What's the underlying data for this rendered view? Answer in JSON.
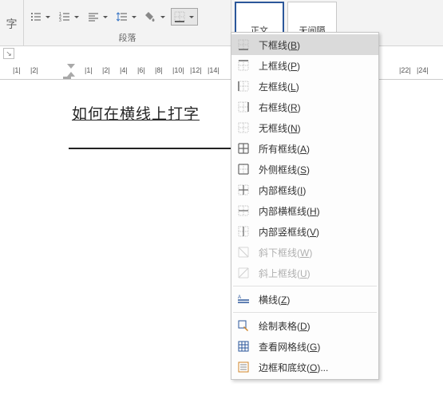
{
  "ribbon": {
    "paragraph_group_label": "段落"
  },
  "styles": {
    "normal": "正文",
    "no_spacing": "无间隔"
  },
  "ruler": {
    "ticks": [
      "1",
      "2",
      "1",
      "2",
      "4",
      "6",
      "8",
      "10",
      "12",
      "14",
      "22",
      "24"
    ]
  },
  "document": {
    "text": "如何在横线上打字"
  },
  "border_menu": {
    "items": [
      {
        "label": "下框线",
        "accel": "B",
        "icon": "border-bottom",
        "highlight": true
      },
      {
        "label": "上框线",
        "accel": "P",
        "icon": "border-top"
      },
      {
        "label": "左框线",
        "accel": "L",
        "icon": "border-left"
      },
      {
        "label": "右框线",
        "accel": "R",
        "icon": "border-right"
      },
      {
        "label": "无框线",
        "accel": "N",
        "icon": "border-none"
      },
      {
        "label": "所有框线",
        "accel": "A",
        "icon": "border-all"
      },
      {
        "label": "外侧框线",
        "accel": "S",
        "icon": "border-outside"
      },
      {
        "label": "内部框线",
        "accel": "I",
        "icon": "border-inside"
      },
      {
        "label": "内部横框线",
        "accel": "H",
        "icon": "border-inside-h"
      },
      {
        "label": "内部竖框线",
        "accel": "V",
        "icon": "border-inside-v"
      },
      {
        "label": "斜下框线",
        "accel": "W",
        "icon": "border-diag-down",
        "disabled": true
      },
      {
        "label": "斜上框线",
        "accel": "U",
        "icon": "border-diag-up",
        "disabled": true
      },
      {
        "sep": true
      },
      {
        "label": "横线",
        "accel": "Z",
        "icon": "horizontal-line"
      },
      {
        "sep": true
      },
      {
        "label": "绘制表格",
        "accel": "D",
        "icon": "draw-table"
      },
      {
        "label": "查看网格线",
        "accel": "G",
        "icon": "view-gridlines"
      },
      {
        "label": "边框和底纹",
        "accel": "O",
        "suffix": "...",
        "icon": "borders-shading"
      }
    ]
  }
}
